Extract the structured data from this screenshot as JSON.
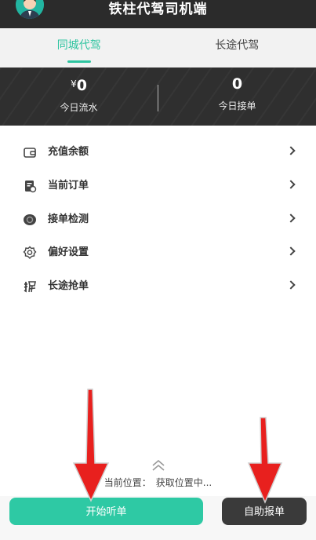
{
  "header": {
    "title": "铁柱代驾司机端"
  },
  "tabs": [
    {
      "label": "同城代驾",
      "active": true
    },
    {
      "label": "长途代驾",
      "active": false
    }
  ],
  "stats": {
    "flow": {
      "currency": "¥",
      "value": "0",
      "label": "今日流水"
    },
    "orders": {
      "value": "0",
      "label": "今日接单"
    }
  },
  "menu": [
    {
      "label": "充值余额",
      "icon": "wallet-icon"
    },
    {
      "label": "当前订单",
      "icon": "order-icon"
    },
    {
      "label": "接单检测",
      "icon": "detect-icon"
    },
    {
      "label": "偏好设置",
      "icon": "gear-icon"
    },
    {
      "label": "长途抢单",
      "icon": "grab-icon"
    }
  ],
  "location": {
    "label": "当前位置：",
    "value": "获取位置中..."
  },
  "buttons": {
    "start": "开始听单",
    "self_order": "自助报单"
  },
  "colors": {
    "accent": "#2ec9a4",
    "dark": "#2b2b2b",
    "arrow": "#e8201e"
  }
}
